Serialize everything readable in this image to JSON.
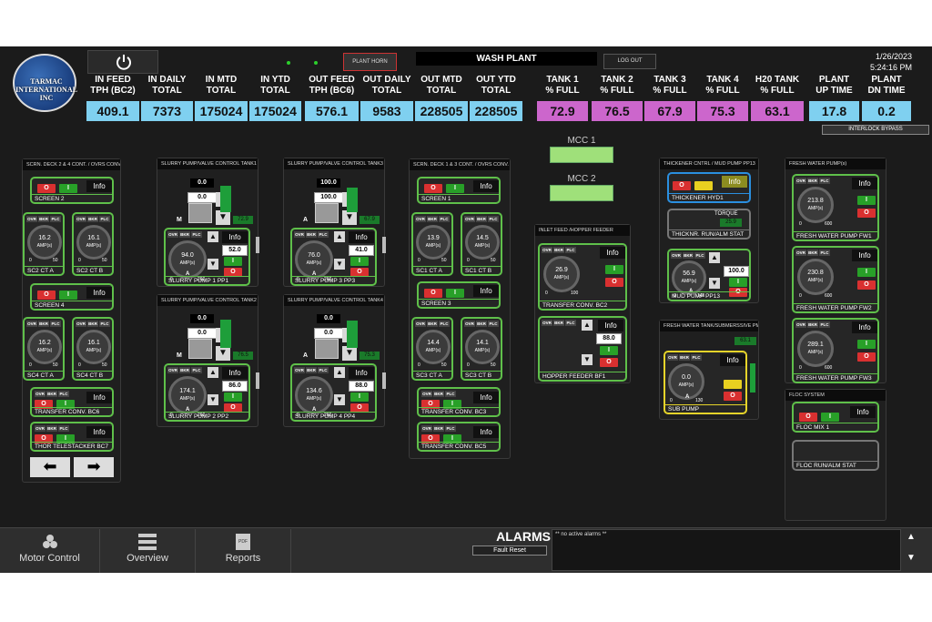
{
  "header": {
    "date": "1/26/2023",
    "time": "5:24:16 PM",
    "plant_horn": "PLANT HORN",
    "title": "WASH PLANT",
    "logout": "LOG OUT",
    "interlock_bypass": "INTERLOCK BYPASS",
    "logo_text": "TARMAC INTERNATIONAL INC"
  },
  "metrics": [
    {
      "l1": "IN FEED",
      "l2": "TPH (BC2)",
      "v": "409.1"
    },
    {
      "l1": "IN DAILY",
      "l2": "TOTAL",
      "v": "7373"
    },
    {
      "l1": "IN MTD",
      "l2": "TOTAL",
      "v": "175024"
    },
    {
      "l1": "IN YTD",
      "l2": "TOTAL",
      "v": "175024"
    },
    {
      "l1": "OUT FEED",
      "l2": "TPH (BC6)",
      "v": "576.1"
    },
    {
      "l1": "OUT DAILY",
      "l2": "TOTAL",
      "v": "9583"
    },
    {
      "l1": "OUT MTD",
      "l2": "TOTAL",
      "v": "228505"
    },
    {
      "l1": "OUT YTD",
      "l2": "TOTAL",
      "v": "228505"
    },
    {
      "l1": "TANK 1",
      "l2": "% FULL",
      "v": "72.9"
    },
    {
      "l1": "TANK 2",
      "l2": "% FULL",
      "v": "76.5"
    },
    {
      "l1": "TANK 3",
      "l2": "% FULL",
      "v": "67.9"
    },
    {
      "l1": "TANK 4",
      "l2": "% FULL",
      "v": "75.3"
    },
    {
      "l1": "H20 TANK",
      "l2": "% FULL",
      "v": "63.1"
    },
    {
      "l1": "PLANT",
      "l2": "UP TIME",
      "v": "17.8"
    },
    {
      "l1": "PLANT",
      "l2": "DN TIME",
      "v": "0.2"
    }
  ],
  "common": {
    "ovr": "OVR",
    "bkr": "BKR",
    "plc": "PLC",
    "info": "Info",
    "amps": "AMP(s)",
    "o": "O",
    "i": "I",
    "m": "M",
    "a": "A",
    "torque": "TORQUE"
  },
  "panels": {
    "scrn24": "SCRN. DECK 2 & 4 CONT. / OVRS CONV.",
    "tank1": "SLURRY PUMP/VALVE CONTROL TANK1",
    "tank3": "SLURRY PUMP/VALVE CONTROL TANK3",
    "tank2": "SLURRY PUMP/VALVE CONTROL TANK2",
    "tank4": "SLURRY PUMP/VALVE CONTROL TANK4",
    "scrn13": "SCRN. DECK 1 & 3 CONT. / OVRS CONV.",
    "inlet": "INLET FEED /HOPPER FEEDER",
    "thick": "THICKENER CNTRL / MUD PUMP PP13",
    "fwsub": "FRESH WATER TANK/SUBMERSSIVE PMP",
    "fwp": "FRESH WATER PUMP(s)",
    "floc": "FLOC SYSTEM"
  },
  "mcc": {
    "m1": "MCC 1",
    "m2": "MCC 2"
  },
  "motors": {
    "screen2": "SCREEN 2",
    "sc2a": "SC2 CT A",
    "sc2b": "SC2 CT B",
    "screen4": "SCREEN 4",
    "sc4a": "SC4 CT A",
    "sc4b": "SC4 CT B",
    "bc6": "TRANSFER CONV. BC6",
    "bc7": "THOR TELESTACKER BC7",
    "pp1": "SLURRY PUMP 1 PP1",
    "pp3": "SLURRY PUMP 3 PP3",
    "pp2": "SLURRY PUMP 2 PP2",
    "pp4": "SLURRY PUMP 4 PP4",
    "screen1": "SCREEN 1",
    "sc1a": "SC1 CT A",
    "sc1b": "SC1 CT B",
    "screen3": "SCREEN 3",
    "sc3a": "SC3 CT A",
    "sc3b": "SC3 CT B",
    "bc3": "TRANSFER CONV. BC3",
    "bc5": "TRANSFER CONV. BC5",
    "bc2": "TRANSFER CONV. BC2",
    "bf1": "HOPPER FEEDER BF1",
    "hyd1": "THICKENER HYD1",
    "thstat": "THICKNR. RUN/ALM STAT",
    "pp13": "MUD PUMP PP13",
    "sub": "SUB PUMP",
    "fw1": "FRESH WATER PUMP FW1",
    "fw2": "FRESH WATER PUMP FW2",
    "fw3": "FRESH WATER PUMP FW3",
    "floc1": "FLOC MIX 1",
    "flocstat": "FLOC RUN/ALM STAT"
  },
  "values": {
    "sc2a": "16.2",
    "sc2b": "16.1",
    "sc4a": "16.2",
    "sc4b": "16.1",
    "pp1": "94.0",
    "pp1_sp": "52.0",
    "pp1_v1": "0.0",
    "pp1_v2": "0.0",
    "t1": "72.9",
    "pp3": "76.0",
    "pp3_sp": "41.0",
    "pp3_v1": "100.0",
    "pp3_v2": "100.0",
    "t3": "67.9",
    "pp2": "174.1",
    "pp2_sp": "86.0",
    "pp2_v1": "0.0",
    "pp2_v2": "0.0",
    "t2": "76.5",
    "pp4": "134.6",
    "pp4_sp": "88.0",
    "pp4_v1": "0.0",
    "pp4_v2": "0.0",
    "t4": "75.3",
    "sc1a": "13.9",
    "sc1b": "14.5",
    "sc3a": "14.4",
    "sc3b": "14.1",
    "bc2": "26.9",
    "bf1_sp": "88.0",
    "torque": "25.9",
    "pp13": "56.9",
    "pp13_sp": "100.0",
    "h2o": "63.1",
    "sub": "0.0",
    "fw1": "213.8",
    "fw2": "230.8",
    "fw3": "289.1",
    "min0": "0",
    "max50": "50",
    "max260": "260",
    "max100": "100",
    "max140": "140",
    "max130": "130",
    "max600": "600"
  },
  "footer": {
    "motor_control": "Motor Control",
    "overview": "Overview",
    "reports": "Reports",
    "pdf": "PDF",
    "alarms": "ALARMS",
    "fault_reset": "Fault Reset",
    "alarm_text": "** no active alarms **"
  },
  "colors": {
    "accent": "#5fc04a",
    "metric_blue": "#7fd0f0",
    "metric_purple": "#cc66cc",
    "stop": "#d93030",
    "run": "#28a028"
  }
}
